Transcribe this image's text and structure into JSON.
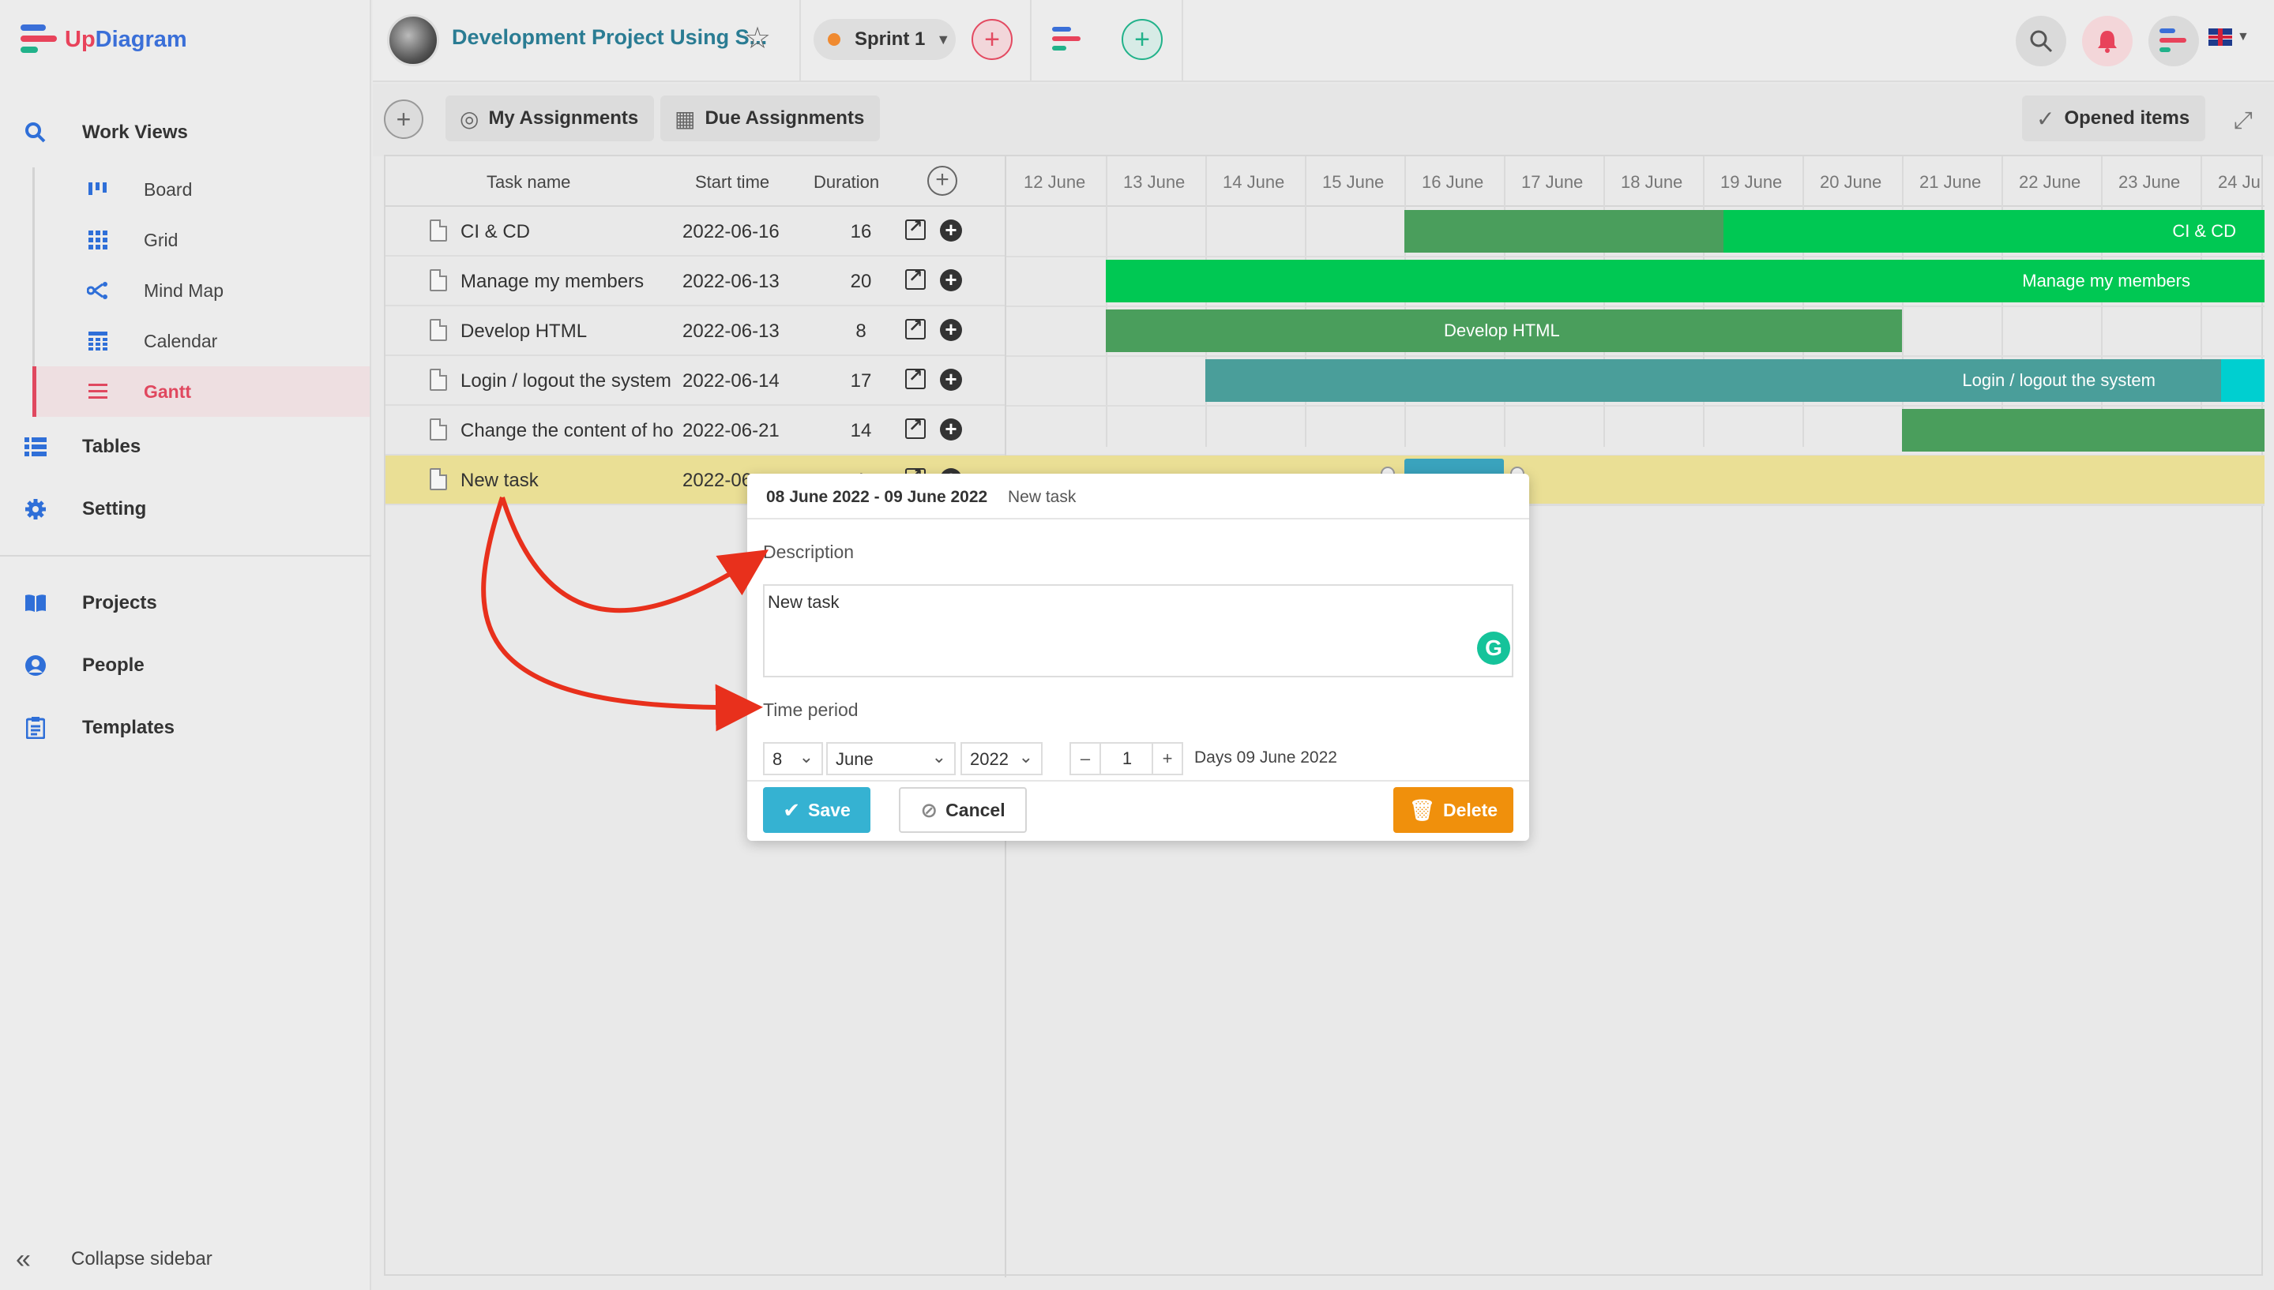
{
  "brand": {
    "prefix": "Up",
    "name": "Diagram"
  },
  "sidebar": {
    "work_views": "Work Views",
    "items": [
      {
        "label": "Board",
        "icon": "board-icon"
      },
      {
        "label": "Grid",
        "icon": "grid-icon"
      },
      {
        "label": "Mind Map",
        "icon": "mind-map-icon"
      },
      {
        "label": "Calendar",
        "icon": "calendar-icon"
      },
      {
        "label": "Gantt",
        "icon": "gantt-icon"
      }
    ],
    "tables": "Tables",
    "setting": "Setting",
    "projects": "Projects",
    "people": "People",
    "templates": "Templates",
    "collapse": "Collapse sidebar"
  },
  "topbar": {
    "project_title": "Development Project Using S...",
    "sprint": "Sprint 1"
  },
  "toolbar": {
    "my_assignments": "My Assignments",
    "due_assignments": "Due Assignments",
    "opened_items": "Opened items"
  },
  "gantt": {
    "columns": {
      "task": "Task name",
      "start": "Start time",
      "duration": "Duration"
    },
    "dates": [
      "12 June",
      "13 June",
      "14 June",
      "15 June",
      "16 June",
      "17 June",
      "18 June",
      "19 June",
      "20 June",
      "21 June",
      "22 June",
      "23 June",
      "24 Ju"
    ],
    "tasks": [
      {
        "name": "CI & CD",
        "start": "2022-06-16",
        "duration": "16"
      },
      {
        "name": "Manage my members",
        "start": "2022-06-13",
        "duration": "20"
      },
      {
        "name": "Develop HTML",
        "start": "2022-06-13",
        "duration": "8"
      },
      {
        "name": "Login / logout the system",
        "start": "2022-06-14",
        "duration": "17"
      },
      {
        "name": "Change the content of home page",
        "start": "2022-06-21",
        "duration": "14"
      },
      {
        "name": "New task",
        "start": "2022-06-08",
        "duration": "1"
      }
    ],
    "bar_labels": [
      "CI & CD",
      "Manage my members",
      "Develop HTML",
      "Login / logout the system"
    ]
  },
  "popup": {
    "date_range": "08 June 2022 - 09 June 2022",
    "task_name": "New task",
    "description_label": "Description",
    "description_value": "New task",
    "time_period_label": "Time period",
    "day": "8",
    "month": "June",
    "year": "2022",
    "minus": "–",
    "count": "1",
    "plus": "+",
    "days_text": "Days 09 June 2022",
    "save": "Save",
    "cancel": "Cancel",
    "delete": "Delete",
    "grammarly": "G"
  },
  "colors": {
    "accent": "#e0485f",
    "bar_green": "#00c853",
    "bar_dark_green": "#4a9e5c",
    "bar_teal": "#4a9e9a",
    "save": "#35b2d2",
    "delete": "#f0900c"
  }
}
